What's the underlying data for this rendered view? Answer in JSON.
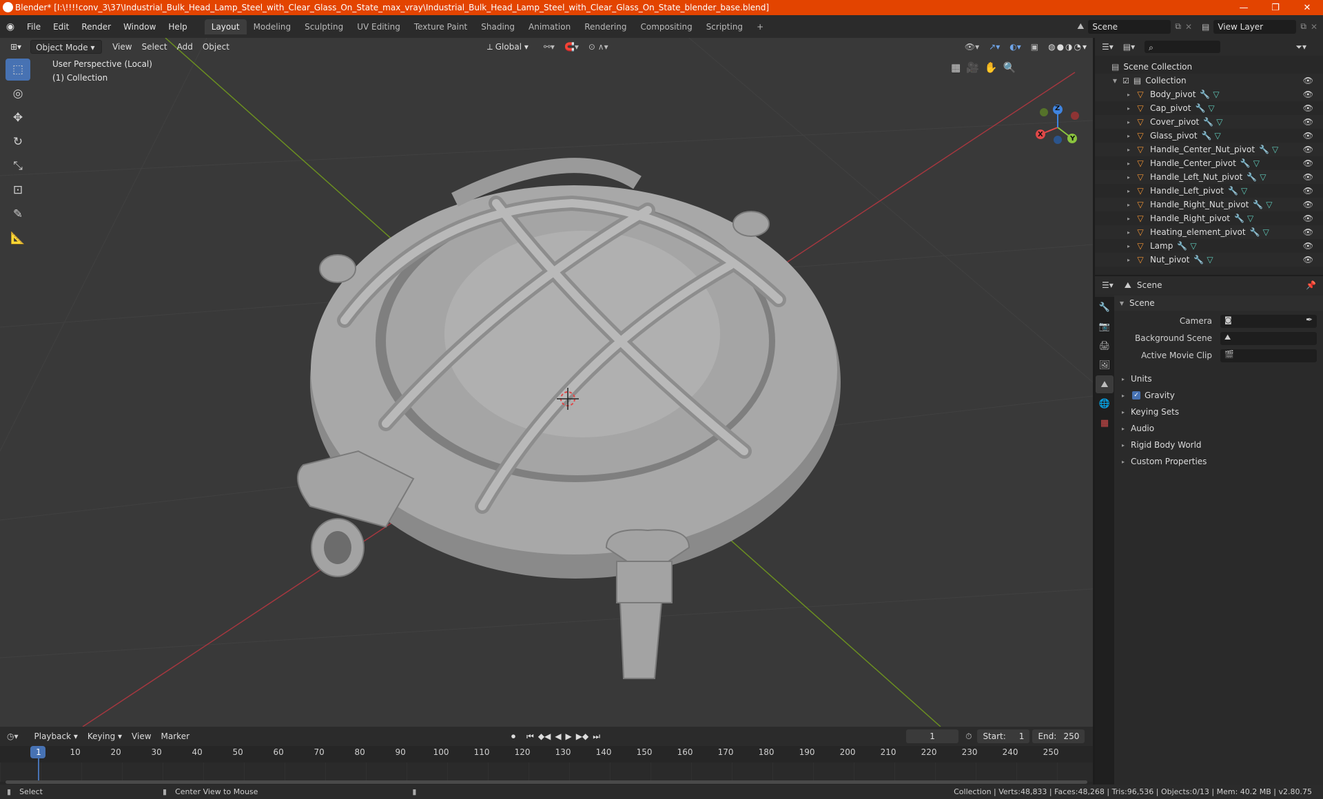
{
  "window": {
    "title": "Blender* [I:\\!!!!conv_3\\37\\Industrial_Bulk_Head_Lamp_Steel_with_Clear_Glass_On_State_max_vray\\Industrial_Bulk_Head_Lamp_Steel_with_Clear_Glass_On_State_blender_base.blend]",
    "minimize": "—",
    "maximize": "❐",
    "close": "✕"
  },
  "menu": [
    "File",
    "Edit",
    "Render",
    "Window",
    "Help"
  ],
  "workspaces": [
    "Layout",
    "Modeling",
    "Sculpting",
    "UV Editing",
    "Texture Paint",
    "Shading",
    "Animation",
    "Rendering",
    "Compositing",
    "Scripting"
  ],
  "workspace_add": "+",
  "scene_field": "Scene",
  "view_layer_field": "View Layer",
  "viewport": {
    "mode": "Object Mode",
    "menus": [
      "View",
      "Select",
      "Add",
      "Object"
    ],
    "orientation": "Global",
    "info_line1": "User Perspective (Local)",
    "info_line2": "(1) Collection",
    "gizmo": {
      "x": "X",
      "y": "Y",
      "z": "Z"
    }
  },
  "outliner": {
    "root": "Scene Collection",
    "collection": "Collection",
    "objects": [
      "Body_pivot",
      "Cap_pivot",
      "Cover_pivot",
      "Glass_pivot",
      "Handle_Center_Nut_pivot",
      "Handle_Center_pivot",
      "Handle_Left_Nut_pivot",
      "Handle_Left_pivot",
      "Handle_Right_Nut_pivot",
      "Handle_Right_pivot",
      "Heating_element_pivot",
      "Lamp",
      "Nut_pivot"
    ]
  },
  "properties": {
    "context": "Scene",
    "panel_title": "Scene",
    "camera_label": "Camera",
    "background_label": "Background Scene",
    "movie_clip_label": "Active Movie Clip",
    "sections": [
      "Units",
      "Gravity",
      "Keying Sets",
      "Audio",
      "Rigid Body World",
      "Custom Properties"
    ]
  },
  "timeline": {
    "menus": [
      "Playback",
      "Keying",
      "View",
      "Marker"
    ],
    "current_frame": "1",
    "start_label": "Start:",
    "start": "1",
    "end_label": "End:",
    "end": "250",
    "ticks": [
      "1",
      "10",
      "20",
      "30",
      "40",
      "50",
      "60",
      "70",
      "80",
      "90",
      "100",
      "110",
      "120",
      "130",
      "140",
      "150",
      "160",
      "170",
      "180",
      "190",
      "200",
      "210",
      "220",
      "230",
      "240",
      "250"
    ]
  },
  "status": {
    "left": "Select",
    "middle": "Center View to Mouse",
    "right": "Collection | Verts:48,833 | Faces:48,268 | Tris:96,536 | Objects:0/13 | Mem: 40.2 MB | v2.80.75"
  }
}
